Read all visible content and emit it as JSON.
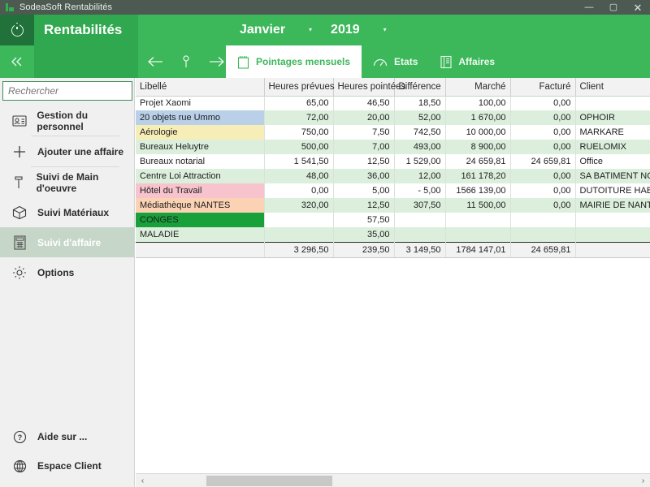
{
  "window": {
    "title": "SodeaSoft Rentabilités",
    "logo_icon": "sodeasoft-logo-icon",
    "minimize_label": "—",
    "maximize_label": "▢",
    "close_label": "✕"
  },
  "header": {
    "power_icon": "power-icon",
    "brand": "Rentabilités",
    "month": "Janvier",
    "month_caret": "▾",
    "year": "2019",
    "year_caret": "▾"
  },
  "tabbar": {
    "collapse_icon": "double-chevron-left-icon",
    "back_icon": "arrow-left-icon",
    "pin_icon": "pin-icon",
    "forward_icon": "arrow-right-icon",
    "tabs": [
      {
        "label": "Pointages mensuels",
        "icon": "notepad-icon",
        "active": true
      },
      {
        "label": "Etats",
        "icon": "gauge-icon",
        "active": false
      },
      {
        "label": "Affaires",
        "icon": "book-icon",
        "active": false
      }
    ]
  },
  "sidebar": {
    "search": {
      "placeholder": "Rechercher",
      "value": ""
    },
    "items": [
      {
        "label": "Gestion du personnel",
        "icon": "id-card-icon",
        "active": false
      },
      {
        "label": "Ajouter une affaire",
        "icon": "plus-icon",
        "active": false
      },
      {
        "label": "Suivi de Main d'oeuvre",
        "icon": "hammer-icon",
        "active": false
      },
      {
        "label": "Suivi Matériaux",
        "icon": "box-icon",
        "active": false
      },
      {
        "label": "Suivi d'affaire",
        "icon": "calculator-icon",
        "active": true
      },
      {
        "label": "Options",
        "icon": "gear-icon",
        "active": false
      }
    ],
    "bottom_items": [
      {
        "label": "Aide sur ...",
        "icon": "question-circle-icon"
      },
      {
        "label": "Espace Client",
        "icon": "globe-icon"
      }
    ]
  },
  "table": {
    "columns": [
      {
        "key": "libelle",
        "label": "Libellé",
        "align": "left"
      },
      {
        "key": "heures_prevues",
        "label": "Heures prévues",
        "align": "right"
      },
      {
        "key": "heures_pointees",
        "label": "Heures pointées",
        "align": "right"
      },
      {
        "key": "difference",
        "label": "Différence",
        "align": "right"
      },
      {
        "key": "marche",
        "label": "Marché",
        "align": "right"
      },
      {
        "key": "facture",
        "label": "Facturé",
        "align": "right"
      },
      {
        "key": "client",
        "label": "Client",
        "align": "left"
      }
    ],
    "rows": [
      {
        "libelle": "Projet Xaomi",
        "label_style": "white",
        "row_style": "norm",
        "heures_prevues": "65,00",
        "heures_pointees": "46,50",
        "difference": "18,50",
        "difference_red": false,
        "marche": "100,00",
        "facture": "0,00",
        "facture_red": true,
        "client": ""
      },
      {
        "libelle": "20 objets rue Ummo",
        "label_style": "blue",
        "row_style": "alt",
        "heures_prevues": "72,00",
        "heures_pointees": "20,00",
        "difference": "52,00",
        "difference_red": true,
        "marche": "1 670,00",
        "facture": "0,00",
        "facture_red": true,
        "client": "OPHOIR"
      },
      {
        "libelle": "Aérologie",
        "label_style": "yellow",
        "row_style": "norm",
        "heures_prevues": "750,00",
        "heures_pointees": "7,50",
        "difference": "742,50",
        "difference_red": true,
        "marche": "10 000,00",
        "facture": "0,00",
        "facture_red": true,
        "client": "MARKARE"
      },
      {
        "libelle": "Bureaux  Heluytre",
        "label_style": "alt",
        "row_style": "alt",
        "heures_prevues": "500,00",
        "heures_pointees": "7,00",
        "difference": "493,00",
        "difference_red": true,
        "marche": "8 900,00",
        "facture": "0,00",
        "facture_red": true,
        "client": "RUELOMIX"
      },
      {
        "libelle": "Bureaux notarial",
        "label_style": "white",
        "row_style": "norm",
        "heures_prevues": "1 541,50",
        "heures_pointees": "12,50",
        "difference": "1 529,00",
        "difference_red": false,
        "marche": "24 659,81",
        "facture": "24 659,81",
        "facture_red": false,
        "client": "Office"
      },
      {
        "libelle": "Centre Loi Attraction",
        "label_style": "alt",
        "row_style": "alt",
        "heures_prevues": "48,00",
        "heures_pointees": "36,00",
        "difference": "12,00",
        "difference_red": true,
        "marche": "161 178,20",
        "facture": "0,00",
        "facture_red": true,
        "client": "SA BATIMENT NORD EST"
      },
      {
        "libelle": "Hôtel du Travail",
        "label_style": "pink",
        "row_style": "norm",
        "heures_prevues": "0,00",
        "heures_pointees": "5,00",
        "difference": "- 5,00",
        "difference_red": true,
        "marche": "1566 139,00",
        "facture": "0,00",
        "facture_red": true,
        "client": "DUTOITURE HABITAT"
      },
      {
        "libelle": "Médiathèque NANTES",
        "label_style": "orange",
        "row_style": "alt",
        "heures_prevues": "320,00",
        "heures_pointees": "12,50",
        "difference": "307,50",
        "difference_red": true,
        "marche": "11 500,00",
        "facture": "0,00",
        "facture_red": true,
        "client": "MAIRIE DE NANTES"
      },
      {
        "libelle": "CONGES",
        "label_style": "green",
        "row_style": "norm",
        "heures_prevues": "",
        "heures_pointees": "57,50",
        "difference": "",
        "difference_red": false,
        "marche": "",
        "facture": "",
        "facture_red": false,
        "client": ""
      },
      {
        "libelle": "MALADIE",
        "label_style": "alt",
        "row_style": "alt",
        "heures_prevues": "",
        "heures_pointees": "35,00",
        "difference": "",
        "difference_red": false,
        "marche": "",
        "facture": "",
        "facture_red": false,
        "client": ""
      }
    ],
    "totals": {
      "libelle": "",
      "heures_prevues": "3 296,50",
      "heures_pointees": "239,50",
      "difference": "3 149,50",
      "marche": "1784 147,01",
      "facture": "24 659,81",
      "client": ""
    }
  },
  "scrollbar": {
    "left_arrow": "‹",
    "right_arrow": "›"
  },
  "colors": {
    "brand_green": "#2fa84f",
    "header_green": "#3cb75a",
    "dark_green": "#21713a",
    "titlebar": "#4c5a52",
    "row_alt": "#dcefdd",
    "negative_red": "#e02020"
  }
}
